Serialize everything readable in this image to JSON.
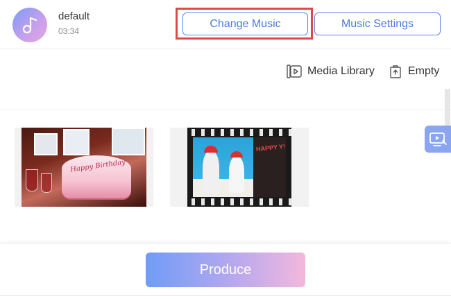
{
  "music": {
    "name": "default",
    "duration": "03:34",
    "change_label": "Change Music",
    "settings_label": "Music Settings"
  },
  "toolbar": {
    "media_library_label": "Media Library",
    "empty_label": "Empty"
  },
  "media": {
    "items": [
      {
        "description_icon": "birthday-cake-photo",
        "cake_text": "Happy Birthday"
      },
      {
        "description_icon": "film-strip-photo",
        "poster_text": "HAPPY Y!"
      }
    ]
  },
  "produce_label": "Produce",
  "colors": {
    "accent": "#4a7ae0",
    "highlight": "#e04848",
    "produce_gradient_start": "#6f9cf7",
    "produce_gradient_end": "#f3b8dc"
  }
}
